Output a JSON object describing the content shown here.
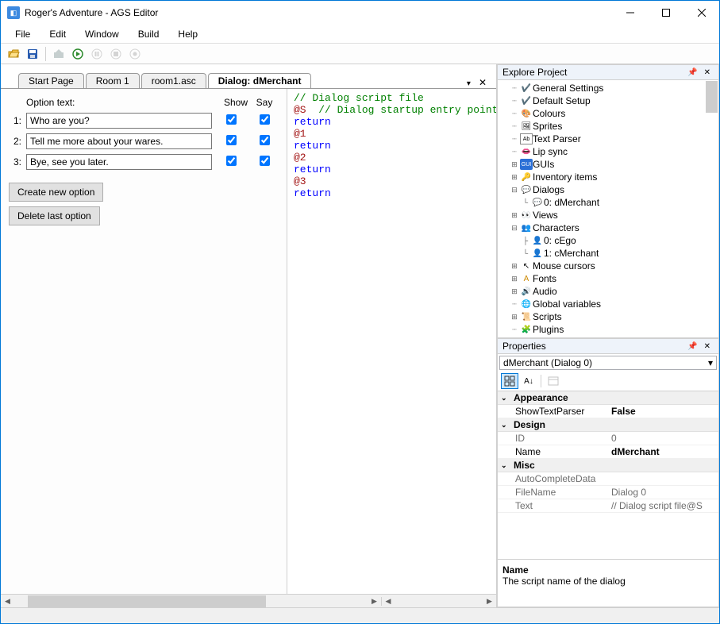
{
  "window": {
    "title": "Roger's Adventure - AGS Editor"
  },
  "menu": {
    "file": "File",
    "edit": "Edit",
    "window": "Window",
    "build": "Build",
    "help": "Help"
  },
  "tabs": {
    "items": [
      {
        "label": "Start Page"
      },
      {
        "label": "Room 1"
      },
      {
        "label": "room1.asc"
      },
      {
        "label": "Dialog: dMerchant"
      }
    ],
    "active": 3
  },
  "dialog_editor": {
    "header": {
      "option_text": "Option text:",
      "show": "Show",
      "say": "Say"
    },
    "options": [
      {
        "n": "1:",
        "text": "Who are you?",
        "show": true,
        "say": true
      },
      {
        "n": "2:",
        "text": "Tell me more about your wares.",
        "show": true,
        "say": true
      },
      {
        "n": "3:",
        "text": "Bye, see you later.",
        "show": true,
        "say": true
      }
    ],
    "btn_create": "Create new option",
    "btn_delete": "Delete last option"
  },
  "script": {
    "l1_comment": "// Dialog script file",
    "l2_at": "@S",
    "l2_comment": "  // Dialog startup entry point",
    "ret": "return",
    "a1": "@1",
    "a2": "@2",
    "a3": "@3"
  },
  "explorer": {
    "title": "Explore Project",
    "items": {
      "general": "General Settings",
      "default_setup": "Default Setup",
      "colours": "Colours",
      "sprites": "Sprites",
      "text_parser": "Text Parser",
      "lip_sync": "Lip sync",
      "guis": "GUIs",
      "inventory": "Inventory items",
      "dialogs": "Dialogs",
      "dialog0": "0: dMerchant",
      "views": "Views",
      "characters": "Characters",
      "char0": "0: cEgo",
      "char1": "1: cMerchant",
      "cursors": "Mouse cursors",
      "fonts": "Fonts",
      "audio": "Audio",
      "globals": "Global variables",
      "scripts": "Scripts",
      "plugins": "Plugins"
    }
  },
  "properties": {
    "title": "Properties",
    "object": "dMerchant (Dialog 0)",
    "cats": {
      "appearance": "Appearance",
      "design": "Design",
      "misc": "Misc"
    },
    "rows": {
      "show_text_parser": {
        "k": "ShowTextParser",
        "v": "False"
      },
      "id": {
        "k": "ID",
        "v": "0"
      },
      "name": {
        "k": "Name",
        "v": "dMerchant"
      },
      "auto": {
        "k": "AutoCompleteData",
        "v": ""
      },
      "filename": {
        "k": "FileName",
        "v": "Dialog 0"
      },
      "text": {
        "k": "Text",
        "v": "// Dialog script file@S"
      }
    },
    "help": {
      "name": "Name",
      "desc": "The script name of the dialog"
    }
  }
}
